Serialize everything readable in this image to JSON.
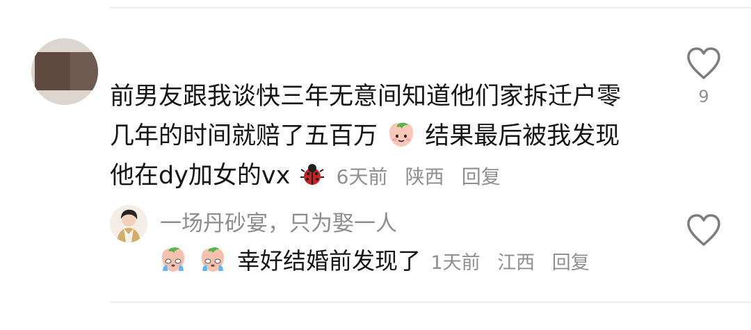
{
  "comment": {
    "text_part_1": "前男友跟我谈快三年无意间知道他们家拆迁户零几年的时间就赔了五百万",
    "text_part_2": "结果最后被我发现他在dy加女的vx",
    "time": "6天前",
    "location": "陕西",
    "reply_label": "回复",
    "like_count": "9",
    "avatar_icon": "avatar-redacted-icon",
    "emoji_1": "peach-face-icon",
    "emoji_2": "ladybug-icon"
  },
  "reply": {
    "username": "一场丹砂宴，只为娶一人",
    "emoji": "crying-peach-icon",
    "text": "幸好结婚前发现了",
    "time": "1天前",
    "location": "江西",
    "reply_label": "回复"
  },
  "colors": {
    "text": "#161616",
    "meta": "#8f8f8f",
    "divider": "#ececec",
    "icon": "#7c7c7c"
  }
}
